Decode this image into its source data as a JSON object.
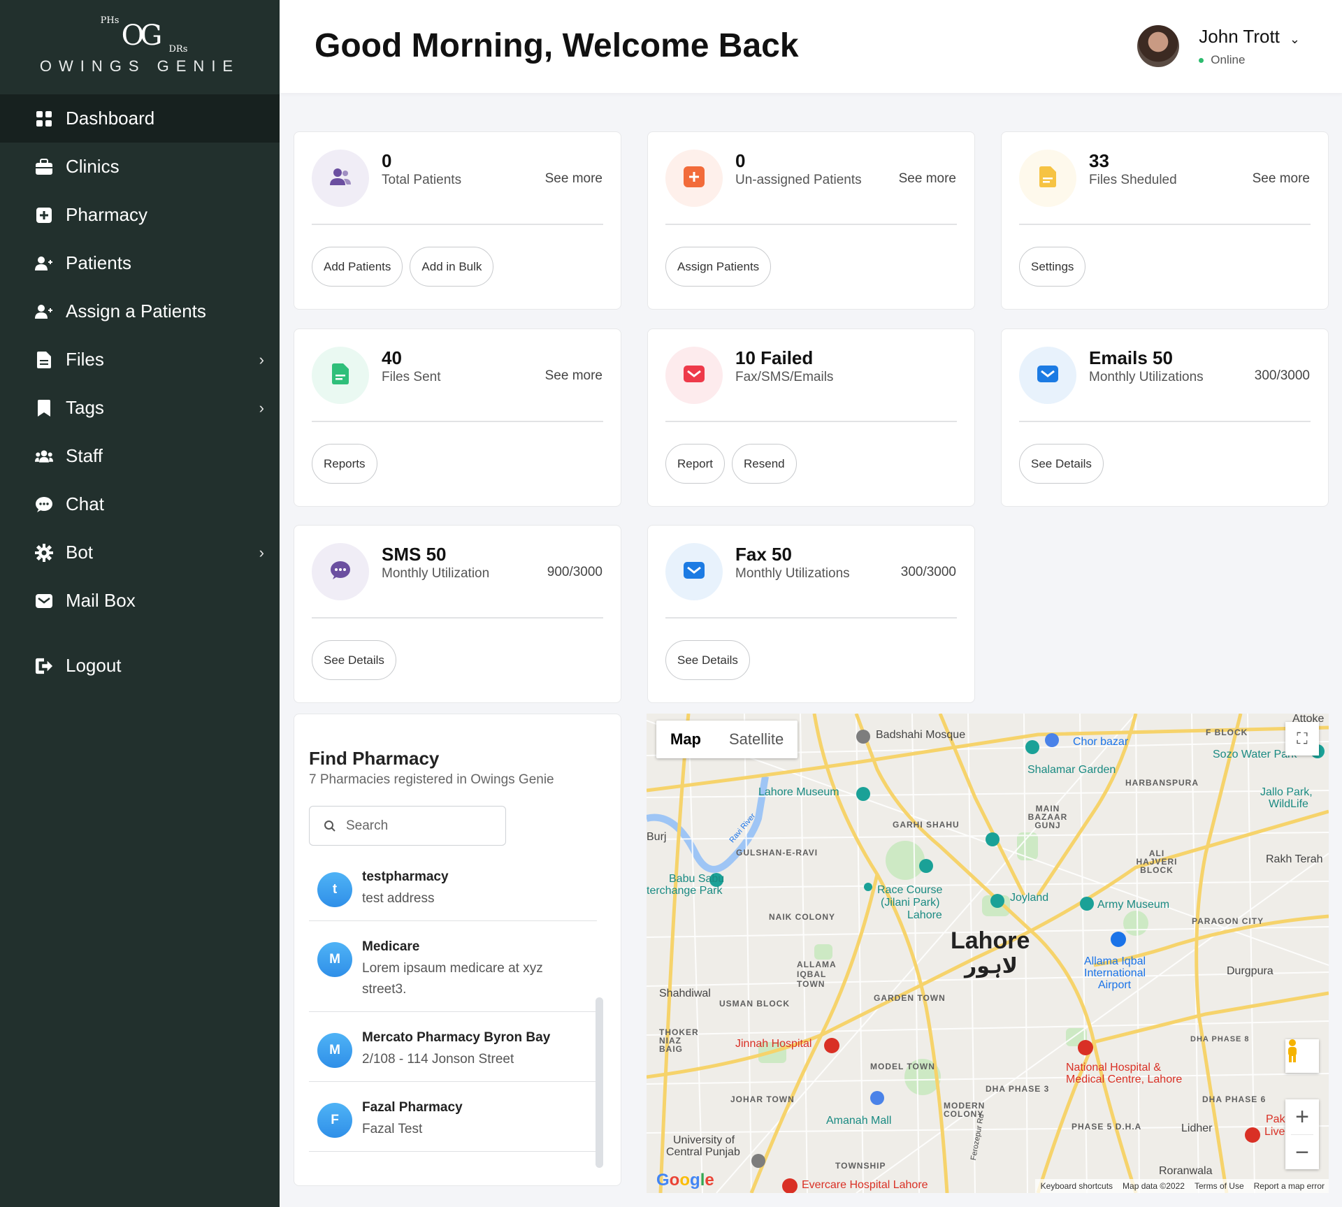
{
  "brand": {
    "top": "OG",
    "phs": "PHs",
    "drs": "DRs",
    "name": "OWINGS GENIE"
  },
  "sidebar": {
    "items": [
      {
        "label": "Dashboard",
        "icon": "dashboard-icon",
        "active": true
      },
      {
        "label": "Clinics",
        "icon": "clinic-icon"
      },
      {
        "label": "Pharmacy",
        "icon": "pharmacy-icon"
      },
      {
        "label": "Patients",
        "icon": "patients-icon"
      },
      {
        "label": "Assign a Patients",
        "icon": "assign-icon"
      },
      {
        "label": "Files",
        "icon": "file-icon",
        "submenu": true
      },
      {
        "label": "Tags",
        "icon": "tag-icon",
        "submenu": true
      },
      {
        "label": "Staff",
        "icon": "staff-icon"
      },
      {
        "label": "Chat",
        "icon": "chat-icon"
      },
      {
        "label": "Bot",
        "icon": "gear-icon",
        "submenu": true
      },
      {
        "label": "Mail Box",
        "icon": "mail-icon"
      }
    ],
    "logout": "Logout"
  },
  "header": {
    "greeting": "Good Morning, Welcome Back",
    "user_name": "John Trott",
    "user_status": "Online"
  },
  "cards": [
    {
      "value": "0",
      "label": "Total Patients",
      "right": "See more",
      "buttons": [
        "Add Patients",
        "Add in Bulk"
      ],
      "icon": "users-icon",
      "color": "#6b4fa0"
    },
    {
      "value": "0",
      "label": "Un-assigned Patients",
      "right": "See more",
      "buttons": [
        "Assign Patients"
      ],
      "icon": "plus-square-icon",
      "color": "#f26b3a"
    },
    {
      "value": "33",
      "label": "Files Sheduled",
      "right": "See more",
      "buttons": [
        "Settings"
      ],
      "icon": "file-icon",
      "color": "#f6c343"
    },
    {
      "value": "40",
      "label": "Files Sent",
      "right": "See more",
      "buttons": [
        "Reports"
      ],
      "icon": "file-sent-icon",
      "color": "#2fbf7a"
    },
    {
      "value": "10 Failed",
      "label": "Fax/SMS/Emails",
      "right": "",
      "buttons": [
        "Report",
        "Resend"
      ],
      "icon": "mail-icon",
      "color": "#ee3a4a"
    },
    {
      "value": "Emails 50",
      "label": "Monthly Utilizations",
      "right": "300/3000",
      "buttons": [
        "See Details"
      ],
      "icon": "mail-icon",
      "color": "#1c7be3"
    },
    {
      "value": "SMS 50",
      "label": "Monthly Utilization",
      "right": "900/3000",
      "buttons": [
        "See Details"
      ],
      "icon": "chat-icon",
      "color": "#6b4fa0"
    },
    {
      "value": "Fax 50",
      "label": "Monthly Utilizations",
      "right": "300/3000",
      "buttons": [
        "See Details"
      ],
      "icon": "mail-icon",
      "color": "#1c7be3"
    }
  ],
  "pharmacy": {
    "title": "Find Pharmacy",
    "subtitle": "7 Pharmacies registered in Owings Genie",
    "search_placeholder": "Search",
    "items": [
      {
        "initial": "t",
        "name": "testpharmacy",
        "address": "test address"
      },
      {
        "initial": "M",
        "name": "Medicare",
        "address": "Lorem ipsaum medicare at xyz street3."
      },
      {
        "initial": "M",
        "name": "Mercato Pharmacy Byron Bay",
        "address": "2/108 - 114 Jonson Street"
      },
      {
        "initial": "F",
        "name": "Fazal Pharmacy",
        "address": "Fazal Test"
      }
    ]
  },
  "map": {
    "tab_map": "Map",
    "tab_satellite": "Satellite",
    "city": "Lahore",
    "city_urdu": "لاہور",
    "labels": {
      "badshahi": "Badshahi Mosque",
      "chor": "Chor bazar",
      "shalamar": "Shalamar Garden",
      "museum": "Lahore Museum",
      "garhi": "GARHI SHAHU",
      "gulshan": "GULSHAN-E-RAVI",
      "babu": "Babu Sabu",
      "interchange": "terchange Park",
      "race": "Race Course",
      "jilani": "(Jilani Park)",
      "lahore2": "Lahore",
      "joyland": "Joyland",
      "army": "Army Museum",
      "naik": "NAIK COLONY",
      "allama": "ALLAMA IQBAL TOWN",
      "airport1": "Allama Iqbal",
      "airport2": "International",
      "airport3": "Airport",
      "paragon": "PARAGON CITY",
      "durgpura": "Durgpura",
      "shahdiwal": "Shahdiwal",
      "usman": "USMAN BLOCK",
      "garden": "GARDEN TOWN",
      "thoker": "THOKER NIAZ BAIG",
      "jinnah": "Jinnah Hospital",
      "model": "MODEL TOWN",
      "national1": "National Hospital &",
      "national2": "Medical Centre, Lahore",
      "dha3": "DHA PHASE 3",
      "dha6": "DHA PHASE 6",
      "dha8": "DHA PHASE 8",
      "johar": "JOHAR TOWN",
      "amanah": "Amanah Mall",
      "modcol": "MODERN COLONY",
      "phase5": "PHASE 5 D.H.A",
      "lidher": "Lidher",
      "univ1": "University of",
      "univ2": "Central Punjab",
      "township": "TOWNSHIP",
      "evercare": "Evercare Hospital Lahore",
      "roranwala": "Roranwala",
      "attoke": "Attoke",
      "fblock": "F BLOCK",
      "sozo": "Sozo Water Park",
      "harbanspura": "HARBANSPURA",
      "jallo1": "Jallo Park,",
      "jallo2": "WildLife",
      "mainbazaar": "MAIN BAZAAR GUNJ",
      "alihajveri": "ALI HAJVERI BLOCK",
      "rakh": "Rakh Terah",
      "burj": "Burj",
      "ravi": "Ravi River",
      "ferozepur": "Ferozepur Rd",
      "pak": "Pak",
      "live": "Live"
    },
    "footer": [
      "Keyboard shortcuts",
      "Map data ©2022",
      "Terms of Use",
      "Report a map error"
    ],
    "google": "Google"
  }
}
